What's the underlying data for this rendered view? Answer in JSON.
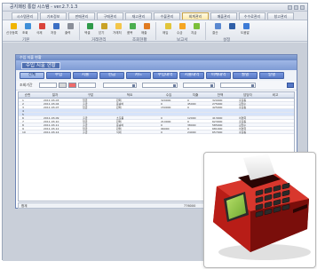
{
  "app": {
    "title": "공지패킹 통합 시스템 - ver.2.7.1.3"
  },
  "ribbon_tabs": [
    "시스템관리",
    "기초정보",
    "판매관리",
    "구매관리",
    "재고관리",
    "수불관리",
    "회계관리",
    "매출관리",
    "수수료관리",
    "창고관리",
    "보고서",
    "도움말"
  ],
  "ribbon_buttons": [
    "신규등록",
    "조회",
    "삭제",
    "저장",
    "출력",
    "엑셀",
    "닫기",
    "거래처",
    "품목",
    "매출",
    "매입",
    "수금",
    "지급",
    "결산",
    "도움말"
  ],
  "ribbon_groups": [
    "기본",
    "거래관리",
    "조회현황",
    "보고서",
    "설정"
  ],
  "inner_window": {
    "title": "수입 지출 현황",
    "header": "수입 지출 현황"
  },
  "tabs": [
    "전체",
    "수입",
    "지출",
    "현금",
    "카드",
    "수입내역",
    "지출내역",
    "이체내역",
    "월별",
    "일별",
    "업체",
    "정산"
  ],
  "filter": {
    "label": "조회기간"
  },
  "grid": {
    "columns": [
      "순번",
      "일자",
      "구분",
      "적요",
      "수입",
      "지출",
      "잔액",
      "담당자",
      "비고"
    ],
    "rows": [
      [
        "1",
        "2011-03-03",
        "입금",
        "판매",
        "320000",
        "0",
        "320000",
        "홍길동",
        ""
      ],
      [
        "2",
        "2011-03-04",
        "출금",
        "운송비",
        "0",
        "45000",
        "275000",
        "김철수",
        ""
      ],
      [
        "3",
        "2011-03-07",
        "입금",
        "판매",
        "150000",
        "0",
        "425000",
        "홍길동",
        ""
      ],
      [
        "4",
        "",
        "",
        "",
        "",
        "",
        "",
        "",
        ""
      ],
      [
        "5",
        "",
        "",
        "",
        "",
        "",
        "",
        "",
        ""
      ],
      [
        "6",
        "2011-03-09",
        "출금",
        "소모품",
        "0",
        "12000",
        "413000",
        "이영희",
        ""
      ],
      [
        "7",
        "2011-03-10",
        "입금",
        "판매",
        "210000",
        "0",
        "623000",
        "홍길동",
        ""
      ],
      [
        "8",
        "2011-03-11",
        "출금",
        "운송비",
        "0",
        "38000",
        "585000",
        "김철수",
        ""
      ],
      [
        "9",
        "2011-03-12",
        "입금",
        "판매",
        "96000",
        "0",
        "681000",
        "이영희",
        ""
      ],
      [
        "10",
        "2011-03-14",
        "출금",
        "식대",
        "0",
        "24000",
        "657000",
        "홍길동",
        ""
      ]
    ],
    "footer_label": "합계",
    "footer_in": "776000",
    "footer_out": "119000"
  },
  "device": {
    "label": "receipt printer payment terminal"
  }
}
